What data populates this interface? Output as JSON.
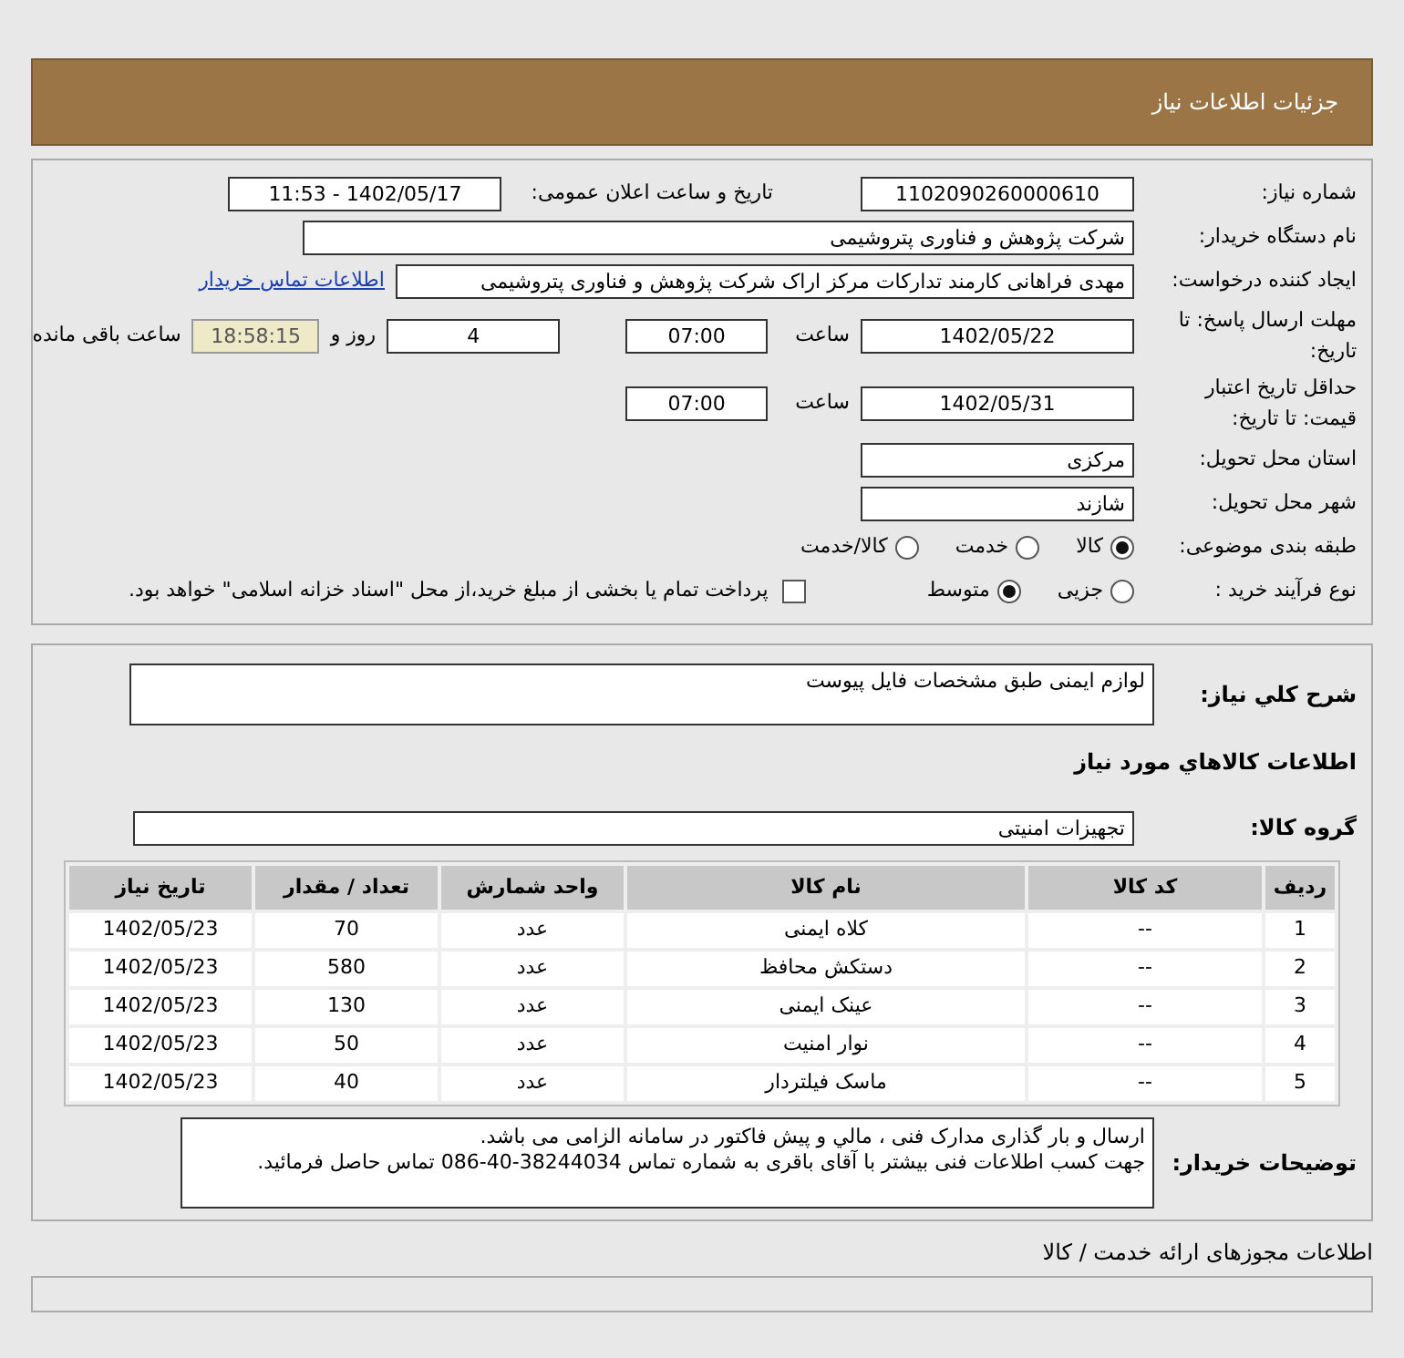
{
  "header": {
    "title": "جزئیات اطلاعات نیاز"
  },
  "need_number": {
    "label": "شماره نیاز:",
    "value": "1102090260000610"
  },
  "announce": {
    "label": "تاریخ و ساعت اعلان عمومی:",
    "value": "1402/05/17 - 11:53"
  },
  "buyer_org": {
    "label": "نام دستگاه خریدار:",
    "value": "شرکت پژوهش و فناوری پتروشیمی"
  },
  "requester": {
    "label": "ایجاد کننده درخواست:",
    "value": "مهدی فراهانی کارمند تدارکات مرکز اراک شرکت پژوهش و فناوری پتروشیمی",
    "link": "اطلاعات تماس خریدار"
  },
  "deadline": {
    "label": "مهلت ارسال پاسخ: تا تاریخ:",
    "date": "1402/05/22",
    "time_label": "ساعت",
    "time": "07:00",
    "days": "4",
    "days_label": "روز و",
    "remaining": "18:58:15",
    "remaining_label": "ساعت باقی مانده"
  },
  "validity": {
    "label": "حداقل تاریخ اعتبار قیمت: تا تاریخ:",
    "date": "1402/05/31",
    "time_label": "ساعت",
    "time": "07:00"
  },
  "province": {
    "label": "استان محل تحویل:",
    "value": "مرکزی"
  },
  "city": {
    "label": "شهر محل تحویل:",
    "value": "شازند"
  },
  "category": {
    "label": "طبقه بندی موضوعی:",
    "options": [
      {
        "label": "کالا",
        "selected": true
      },
      {
        "label": "خدمت",
        "selected": false
      },
      {
        "label": "کالا/خدمت",
        "selected": false
      }
    ]
  },
  "process": {
    "label": "نوع فرآیند خرید :",
    "options": [
      {
        "label": "جزیی",
        "selected": false
      },
      {
        "label": "متوسط",
        "selected": true
      }
    ],
    "treasury": {
      "label": "پرداخت تمام یا بخشی از مبلغ خرید،از محل \"اسناد خزانه اسلامی\" خواهد بود.",
      "checked": false
    }
  },
  "description": {
    "label": "شرح كلي نياز:",
    "value": "لوازم ایمنی طبق مشخصات فایل پیوست"
  },
  "goods_heading": "اطلاعات كالاهاي مورد نياز",
  "goods_group": {
    "label": "گروه کالا:",
    "value": "تجهیزات امنیتی"
  },
  "table": {
    "columns": [
      "ردیف",
      "کد کالا",
      "نام کالا",
      "واحد شمارش",
      "تعداد / مقدار",
      "تاریخ نیاز"
    ],
    "rows": [
      [
        "1",
        "--",
        "کلاه ایمنی",
        "عدد",
        "70",
        "1402/05/23"
      ],
      [
        "2",
        "--",
        "دستکش محافظ",
        "عدد",
        "580",
        "1402/05/23"
      ],
      [
        "3",
        "--",
        "عینک ایمنی",
        "عدد",
        "130",
        "1402/05/23"
      ],
      [
        "4",
        "--",
        "نوار امنیت",
        "عدد",
        "50",
        "1402/05/23"
      ],
      [
        "5",
        "--",
        "ماسک فیلتردار",
        "عدد",
        "40",
        "1402/05/23"
      ]
    ]
  },
  "buyer_notes": {
    "label": "توضیحات خریدار:",
    "lines": [
      "ارسال و بار گذاری مدارک فنی ، مالي و پیش فاکتور در سامانه الزامی می باشد.",
      "جهت کسب اطلاعات فنی بیشتر با آقای باقری به شماره تماس 38244034-40-086 تماس حاصل فرمائید."
    ]
  },
  "permits_heading": "اطلاعات مجوزهای ارائه خدمت / کالا"
}
